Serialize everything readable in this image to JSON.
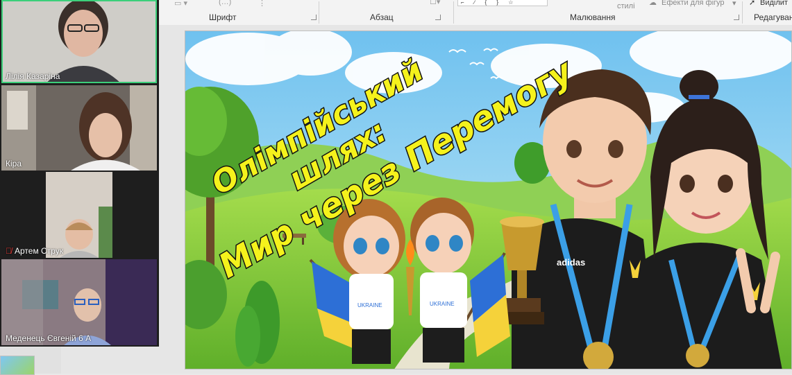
{
  "ribbon": {
    "groups": [
      {
        "label": "Шрифт"
      },
      {
        "label": "Абзац"
      },
      {
        "label": "Малювання"
      },
      {
        "label": "Редагування"
      }
    ],
    "styles_label": "стилі",
    "effects_label": "Ефекти для фігур",
    "select_label": "Виділит"
  },
  "participants": [
    {
      "name": "Лілія Казаріна",
      "active": true,
      "muted": false
    },
    {
      "name": "Кіра",
      "active": false,
      "muted": false
    },
    {
      "name": "Артем Струк",
      "active": false,
      "muted": true
    },
    {
      "name": "Меденець Євгеній 6 А",
      "active": false,
      "muted": false
    }
  ],
  "slide": {
    "title_line1": "Олімпійський",
    "title_line2": "шлях:",
    "title_line3": "Мир через Перемогу",
    "shirt_text": "UKRAINE",
    "jacket_brand": "adidas"
  },
  "colors": {
    "active_speaker": "#3ccf7a",
    "title_fill": "#f5f21c",
    "title_stroke": "#111111",
    "sky": "#8fd3f4",
    "grass": "#7cc83a"
  }
}
